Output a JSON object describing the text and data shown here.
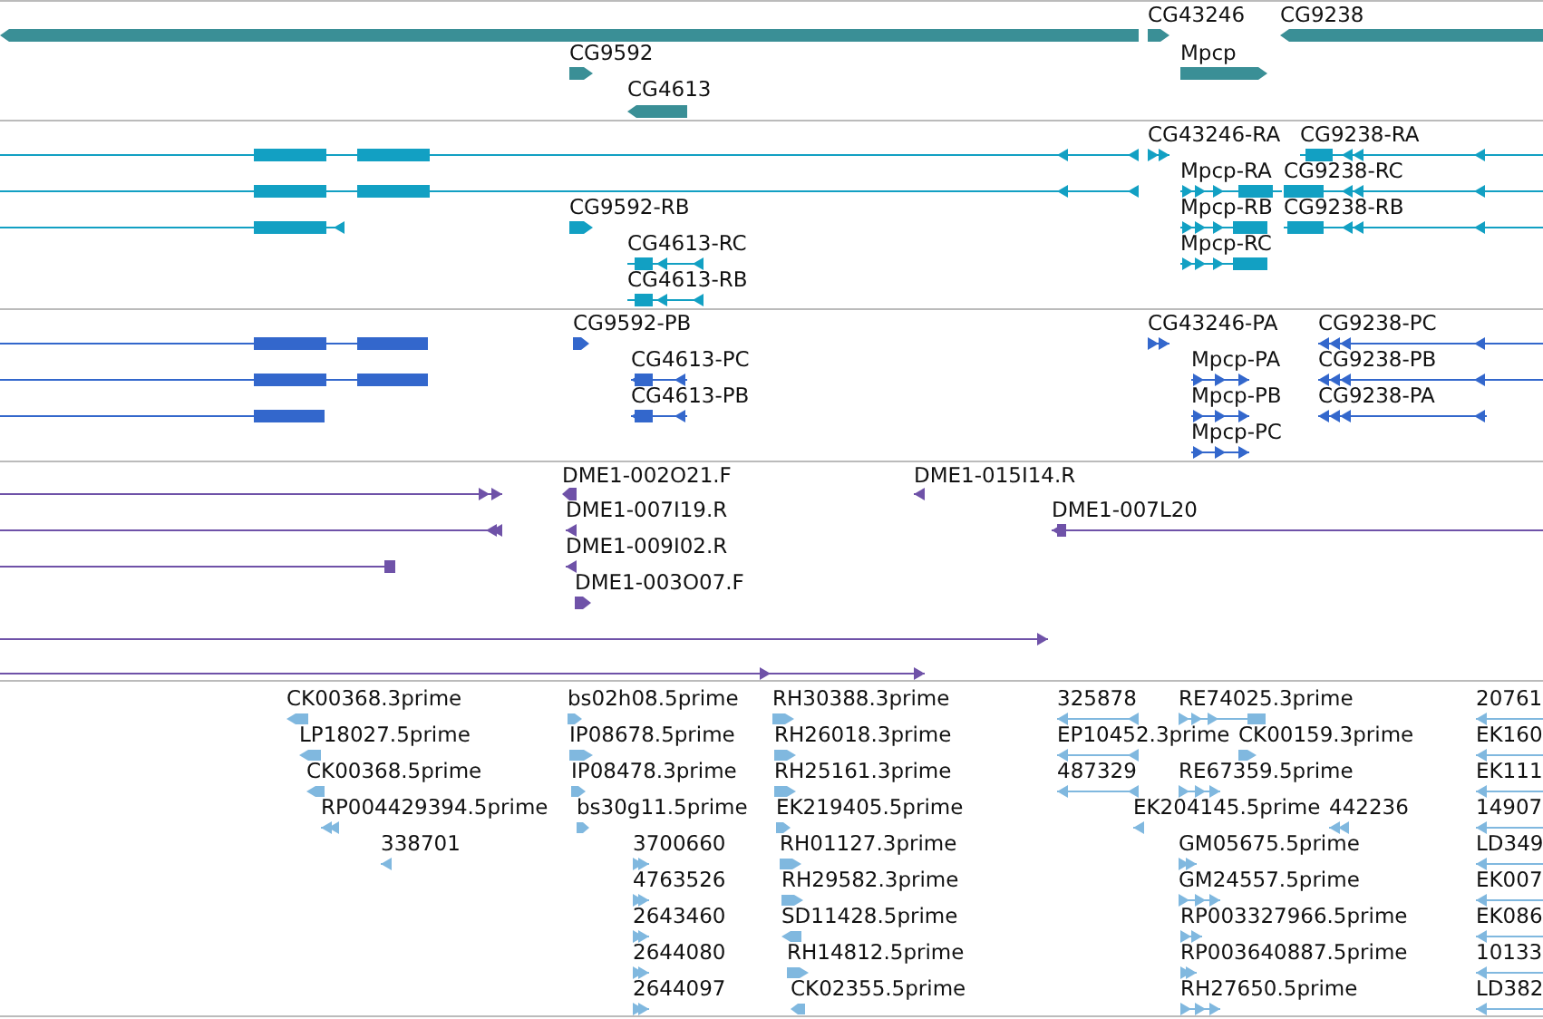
{
  "tracks": [
    {
      "color": "#3a8f96",
      "features": [
        {
          "kind": "block",
          "reverse": true
        },
        {
          "kind": "block",
          "label": "CG43246",
          "reverse": false
        },
        {
          "kind": "block",
          "label": "CG9238",
          "reverse": true
        },
        {
          "kind": "block",
          "label": "CG9592",
          "reverse": false
        },
        {
          "kind": "block",
          "label": "Mpcp",
          "reverse": false
        },
        {
          "kind": "block",
          "label": "CG4613",
          "reverse": true
        }
      ]
    },
    {
      "color": "#12a0c3",
      "features": [
        {
          "kind": "line",
          "reverse": true
        },
        {
          "kind": "line",
          "label": "CG43246-RA",
          "reverse": false
        },
        {
          "kind": "line",
          "label": "CG9238-RA",
          "reverse": true
        },
        {
          "kind": "line",
          "reverse": true
        },
        {
          "kind": "line",
          "label": "Mpcp-RA",
          "reverse": false
        },
        {
          "kind": "line",
          "label": "CG9238-RC",
          "reverse": true
        },
        {
          "kind": "line",
          "reverse": true
        },
        {
          "kind": "block",
          "label": "CG9592-RB",
          "reverse": false
        },
        {
          "kind": "line",
          "label": "Mpcp-RB",
          "reverse": false
        },
        {
          "kind": "line",
          "label": "CG9238-RB",
          "reverse": true
        },
        {
          "kind": "line",
          "label": "CG4613-RC",
          "reverse": true
        },
        {
          "kind": "line",
          "label": "Mpcp-RC",
          "reverse": false
        },
        {
          "kind": "line",
          "label": "CG4613-RB",
          "reverse": true
        }
      ]
    },
    {
      "color": "#3367cc",
      "features": [
        {
          "kind": "line"
        },
        {
          "kind": "block",
          "label": "CG9592-PB",
          "reverse": false
        },
        {
          "kind": "line",
          "label": "CG43246-PA",
          "reverse": false
        },
        {
          "kind": "line",
          "label": "CG9238-PC",
          "reverse": true
        },
        {
          "kind": "line"
        },
        {
          "kind": "line",
          "label": "CG4613-PC",
          "reverse": true
        },
        {
          "kind": "line",
          "label": "Mpcp-PA",
          "reverse": false
        },
        {
          "kind": "line",
          "label": "CG9238-PB",
          "reverse": true
        },
        {
          "kind": "line"
        },
        {
          "kind": "line",
          "label": "CG4613-PB",
          "reverse": true
        },
        {
          "kind": "line",
          "label": "Mpcp-PB",
          "reverse": false
        },
        {
          "kind": "line",
          "label": "CG9238-PA",
          "reverse": true
        },
        {
          "kind": "line",
          "label": "Mpcp-PC",
          "reverse": false
        }
      ]
    },
    {
      "color": "#6f52a8",
      "features": [
        {
          "kind": "line",
          "reverse": false
        },
        {
          "kind": "block",
          "label": "DME1-002O21.F",
          "reverse": true
        },
        {
          "kind": "line",
          "label": "DME1-015I14.R",
          "reverse": true
        },
        {
          "kind": "line",
          "reverse": true
        },
        {
          "kind": "line",
          "label": "DME1-007I19.R",
          "reverse": true
        },
        {
          "kind": "line",
          "label": "DME1-007L20",
          "reverse": true
        },
        {
          "kind": "line"
        },
        {
          "kind": "line",
          "label": "DME1-009I02.R",
          "reverse": true
        },
        {
          "kind": "block",
          "label": "DME1-003O07.F",
          "reverse": false
        },
        {
          "kind": "line",
          "reverse": false
        },
        {
          "kind": "line",
          "reverse": false
        }
      ]
    },
    {
      "color": "#80b8df",
      "features": [
        {
          "kind": "block",
          "label": "CK00368.3prime",
          "reverse": true
        },
        {
          "kind": "block",
          "label": "bs02h08.5prime",
          "reverse": false
        },
        {
          "kind": "block",
          "label": "RH30388.3prime",
          "reverse": false
        },
        {
          "kind": "line",
          "label": "325878",
          "reverse": true
        },
        {
          "kind": "line",
          "label": "RE74025.3prime",
          "reverse": false
        },
        {
          "kind": "line",
          "label": "20761",
          "reverse": true
        },
        {
          "kind": "block",
          "label": "LP18027.5prime",
          "reverse": true
        },
        {
          "kind": "block",
          "label": "IP08678.5prime",
          "reverse": false
        },
        {
          "kind": "block",
          "label": "RH26018.3prime",
          "reverse": false
        },
        {
          "kind": "line",
          "label": "EP10452.3prime",
          "reverse": true
        },
        {
          "kind": "block",
          "label": "CK00159.3prime",
          "reverse": false
        },
        {
          "kind": "line",
          "label": "EK160",
          "reverse": true
        },
        {
          "kind": "block",
          "label": "CK00368.5prime",
          "reverse": true
        },
        {
          "kind": "block",
          "label": "IP08478.3prime",
          "reverse": false
        },
        {
          "kind": "block",
          "label": "RH25161.3prime",
          "reverse": false
        },
        {
          "kind": "line",
          "label": "487329",
          "reverse": true
        },
        {
          "kind": "line",
          "label": "RE67359.5prime",
          "reverse": false
        },
        {
          "kind": "line",
          "label": "EK111",
          "reverse": true
        },
        {
          "kind": "line",
          "label": "RP004429394.5prime",
          "reverse": true
        },
        {
          "kind": "block",
          "label": "bs30g11.5prime",
          "reverse": false
        },
        {
          "kind": "block",
          "label": "EK219405.5prime",
          "reverse": false
        },
        {
          "kind": "line",
          "label": "EK204145.5prime",
          "reverse": true
        },
        {
          "kind": "line",
          "label": "442236",
          "reverse": true
        },
        {
          "kind": "line",
          "label": "14907",
          "reverse": true
        },
        {
          "kind": "line",
          "label": "338701",
          "reverse": true
        },
        {
          "kind": "line",
          "label": "3700660",
          "reverse": false
        },
        {
          "kind": "block",
          "label": "RH01127.3prime",
          "reverse": false
        },
        {
          "kind": "line",
          "label": "GM05675.5prime",
          "reverse": false
        },
        {
          "kind": "line",
          "label": "LD349",
          "reverse": true
        },
        {
          "kind": "line",
          "label": "4763526",
          "reverse": false
        },
        {
          "kind": "block",
          "label": "RH29582.3prime",
          "reverse": false
        },
        {
          "kind": "line",
          "label": "GM24557.5prime",
          "reverse": false
        },
        {
          "kind": "line",
          "label": "EK007",
          "reverse": true
        },
        {
          "kind": "line",
          "label": "2643460",
          "reverse": false
        },
        {
          "kind": "block",
          "label": "SD11428.5prime",
          "reverse": true
        },
        {
          "kind": "line",
          "label": "RP003327966.5prime",
          "reverse": false
        },
        {
          "kind": "line",
          "label": "EK086",
          "reverse": true
        },
        {
          "kind": "line",
          "label": "2644080",
          "reverse": false
        },
        {
          "kind": "block",
          "label": "RH14812.5prime",
          "reverse": false
        },
        {
          "kind": "line",
          "label": "RP003640887.5prime",
          "reverse": false
        },
        {
          "kind": "line",
          "label": "10133",
          "reverse": true
        },
        {
          "kind": "line",
          "label": "2644097",
          "reverse": false
        },
        {
          "kind": "block",
          "label": "CK02355.5prime",
          "reverse": true
        },
        {
          "kind": "line",
          "label": "RH27650.5prime",
          "reverse": false
        },
        {
          "kind": "line",
          "label": "LD382",
          "reverse": true
        }
      ]
    }
  ]
}
